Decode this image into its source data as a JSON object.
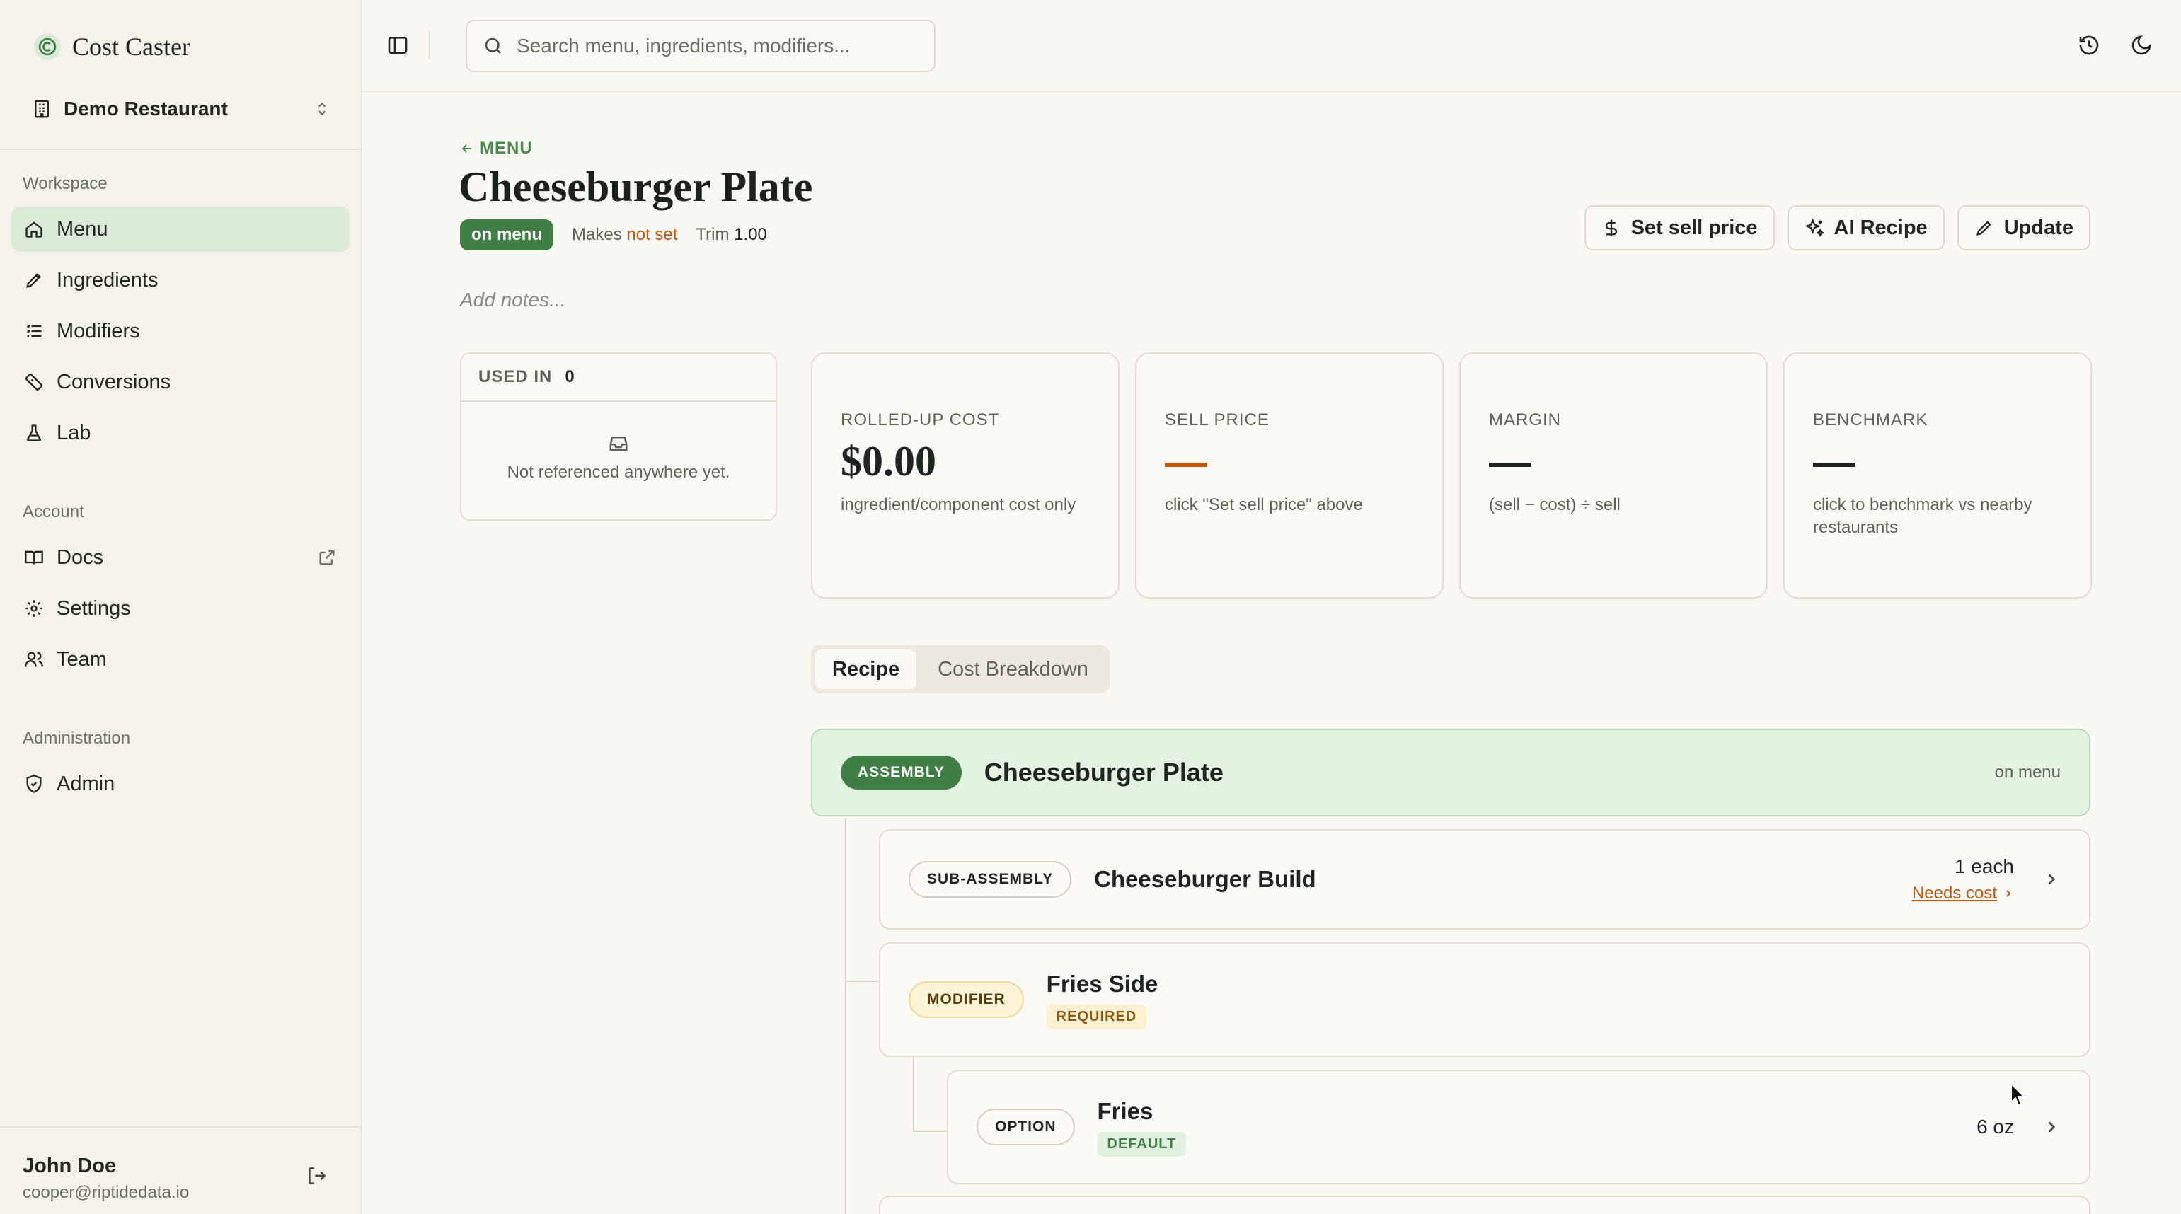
{
  "brand": {
    "name": "Cost Caster"
  },
  "restaurant": {
    "name": "Demo Restaurant"
  },
  "sidebar": {
    "workspace_label": "Workspace",
    "workspace_items": [
      {
        "label": "Menu",
        "icon": "home-icon",
        "active": true
      },
      {
        "label": "Ingredients",
        "icon": "pen-icon"
      },
      {
        "label": "Modifiers",
        "icon": "list-icon"
      },
      {
        "label": "Conversions",
        "icon": "ruler-icon"
      },
      {
        "label": "Lab",
        "icon": "flask-icon"
      }
    ],
    "account_label": "Account",
    "account_items": [
      {
        "label": "Docs",
        "icon": "book-icon"
      },
      {
        "label": "Settings",
        "icon": "gear-icon"
      },
      {
        "label": "Team",
        "icon": "users-icon"
      }
    ],
    "admin_label": "Administration",
    "admin_items": [
      {
        "label": "Admin",
        "icon": "shield-icon"
      }
    ]
  },
  "user": {
    "name": "John Doe",
    "email": "cooper@riptidedata.io"
  },
  "search": {
    "placeholder": "Search menu, ingredients, modifiers..."
  },
  "page": {
    "back_label": "MENU",
    "title": "Cheeseburger Plate",
    "status": "on menu",
    "makes_label": "Makes",
    "makes_value": "not set",
    "trim_label": "Trim",
    "trim_value": "1.00",
    "notes_placeholder": "Add notes..."
  },
  "actions": {
    "set_sell_price": "Set sell price",
    "ai_recipe": "AI Recipe",
    "update": "Update"
  },
  "used_in": {
    "label": "USED IN",
    "count": "0",
    "empty": "Not referenced anywhere yet."
  },
  "stats": [
    {
      "label": "ROLLED-UP COST",
      "value": "$0.00",
      "sub": "ingredient/component cost only"
    },
    {
      "label": "SELL PRICE",
      "value": "—",
      "sub": "click \"Set sell price\" above"
    },
    {
      "label": "MARGIN",
      "value": "—",
      "sub": "(sell − cost) ÷ sell"
    },
    {
      "label": "BENCHMARK",
      "value": "—",
      "sub": "click to benchmark vs nearby restaurants"
    }
  ],
  "tabs": [
    {
      "label": "Recipe",
      "active": true
    },
    {
      "label": "Cost Breakdown",
      "active": false
    }
  ],
  "recipe": {
    "assembly": {
      "badge": "ASSEMBLY",
      "name": "Cheeseburger Plate",
      "status": "on menu"
    },
    "sub_assembly": {
      "badge": "SUB-ASSEMBLY",
      "name": "Cheeseburger Build",
      "qty": "1 each",
      "needs": "Needs cost"
    },
    "modifier": {
      "badge": "MODIFIER",
      "name": "Fries Side",
      "tag": "REQUIRED"
    },
    "option": {
      "badge": "OPTION",
      "name": "Fries",
      "tag": "DEFAULT",
      "qty": "6 oz"
    }
  },
  "colors": {
    "accent": "#3f7f46",
    "warning": "#c2570f",
    "background": "#faf8f3"
  }
}
